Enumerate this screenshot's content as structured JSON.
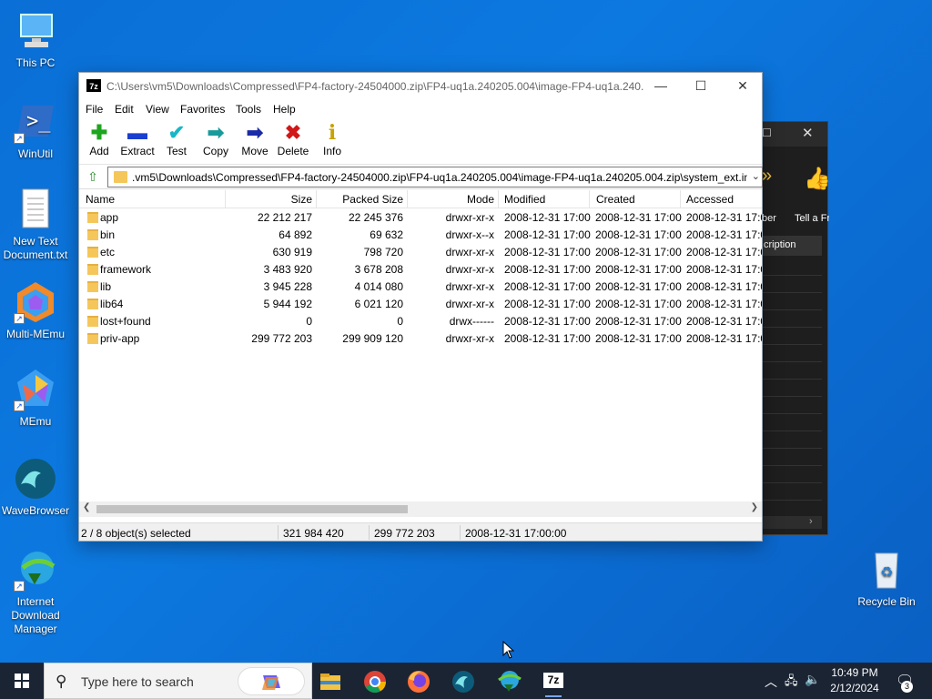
{
  "desktop": {
    "icons": [
      {
        "label": "This PC"
      },
      {
        "label": "WinUtil"
      },
      {
        "label": "New Text Document.txt"
      },
      {
        "label": "Multi-MEmu"
      },
      {
        "label": "MEmu"
      },
      {
        "label": "WaveBrowser"
      },
      {
        "label": "Internet Download Manager"
      },
      {
        "label": "Recycle Bin"
      }
    ]
  },
  "bg_window": {
    "ribbon_label_1": "ber",
    "ribbon_label_2": "Tell a Fr",
    "column_header": "cription"
  },
  "window": {
    "title": "C:\\Users\\vm5\\Downloads\\Compressed\\FP4-factory-24504000.zip\\FP4-uq1a.240205.004\\image-FP4-uq1a.240...",
    "app_icon": "7z",
    "menu": [
      "File",
      "Edit",
      "View",
      "Favorites",
      "Tools",
      "Help"
    ],
    "toolbar": [
      {
        "label": "Add",
        "icon": "add-icon",
        "glyph": "✚",
        "color": "#1ea51e"
      },
      {
        "label": "Extract",
        "icon": "extract-icon",
        "glyph": "▬",
        "color": "#1a3fd0"
      },
      {
        "label": "Test",
        "icon": "test-icon",
        "glyph": "✔",
        "color": "#19b7c5"
      },
      {
        "label": "Copy",
        "icon": "copy-icon",
        "glyph": "➡",
        "color": "#1a9a9a"
      },
      {
        "label": "Move",
        "icon": "move-icon",
        "glyph": "➡",
        "color": "#1a2aa8"
      },
      {
        "label": "Delete",
        "icon": "delete-icon",
        "glyph": "✖",
        "color": "#d01818"
      },
      {
        "label": "Info",
        "icon": "info-icon",
        "glyph": "i",
        "color": "#c8a200"
      }
    ],
    "address": ".vm5\\Downloads\\Compressed\\FP4-factory-24504000.zip\\FP4-uq1a.240205.004\\image-FP4-uq1a.240205.004.zip\\system_ext.img\\",
    "columns": [
      "Name",
      "Size",
      "Packed Size",
      "Mode",
      "Modified",
      "Created",
      "Accessed"
    ],
    "rows": [
      {
        "name": "app",
        "size": "22 212 217",
        "packed": "22 245 376",
        "mode": "drwxr-xr-x",
        "modified": "2008-12-31 17:00",
        "created": "2008-12-31 17:00",
        "accessed": "2008-12-31 17:0"
      },
      {
        "name": "bin",
        "size": "64 892",
        "packed": "69 632",
        "mode": "drwxr-x--x",
        "modified": "2008-12-31 17:00",
        "created": "2008-12-31 17:00",
        "accessed": "2008-12-31 17:0"
      },
      {
        "name": "etc",
        "size": "630 919",
        "packed": "798 720",
        "mode": "drwxr-xr-x",
        "modified": "2008-12-31 17:00",
        "created": "2008-12-31 17:00",
        "accessed": "2008-12-31 17:0"
      },
      {
        "name": "framework",
        "size": "3 483 920",
        "packed": "3 678 208",
        "mode": "drwxr-xr-x",
        "modified": "2008-12-31 17:00",
        "created": "2008-12-31 17:00",
        "accessed": "2008-12-31 17:0"
      },
      {
        "name": "lib",
        "size": "3 945 228",
        "packed": "4 014 080",
        "mode": "drwxr-xr-x",
        "modified": "2008-12-31 17:00",
        "created": "2008-12-31 17:00",
        "accessed": "2008-12-31 17:0"
      },
      {
        "name": "lib64",
        "size": "5 944 192",
        "packed": "6 021 120",
        "mode": "drwxr-xr-x",
        "modified": "2008-12-31 17:00",
        "created": "2008-12-31 17:00",
        "accessed": "2008-12-31 17:0"
      },
      {
        "name": "lost+found",
        "size": "0",
        "packed": "0",
        "mode": "drwx------",
        "modified": "2008-12-31 17:00",
        "created": "2008-12-31 17:00",
        "accessed": "2008-12-31 17:0"
      },
      {
        "name": "priv-app",
        "size": "299 772 203",
        "packed": "299 909 120",
        "mode": "drwxr-xr-x",
        "modified": "2008-12-31 17:00",
        "created": "2008-12-31 17:00",
        "accessed": "2008-12-31 17:0"
      }
    ],
    "status": {
      "selected": "2 / 8 object(s) selected",
      "size": "321 984 420",
      "packed": "299 772 203",
      "date": "2008-12-31 17:00:00"
    }
  },
  "taskbar": {
    "search_placeholder": "Type here to search",
    "apps": [
      "file-explorer",
      "chrome",
      "firefox",
      "wavebrowser",
      "internet-download-manager",
      "7-zip"
    ],
    "app_7z_label": "7z",
    "time": "10:49 PM",
    "date": "2/12/2024",
    "notification_count": "3"
  }
}
